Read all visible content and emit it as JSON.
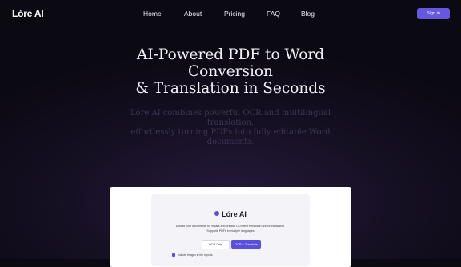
{
  "nav": {
    "logo": "Lóre AI",
    "links": [
      "Home",
      "About",
      "Pricing",
      "FAQ",
      "Blog"
    ],
    "signin": "Sign in"
  },
  "hero": {
    "title_line1": "AI-Powered PDF to Word",
    "title_line2": "Conversion",
    "title_line3": "& Translation in Seconds",
    "sub_line1": "Lóre AI combines powerful OCR and multilingual",
    "sub_line2": "translation,",
    "sub_line3": "effortlessly turning PDFs into fully editable Word",
    "sub_line4": "documents."
  },
  "preview": {
    "brand": "Lóre AI",
    "desc_line1": "Upload your documents for instant and precise OCR text extraction and/or translation.",
    "desc_line2": "Supports PDFs in multiple languages",
    "option_ocr": "OCR Only",
    "option_translate": "OCR + Translate",
    "checkbox_label": "Include images in the reports"
  },
  "colors": {
    "accent": "#6557e0"
  }
}
